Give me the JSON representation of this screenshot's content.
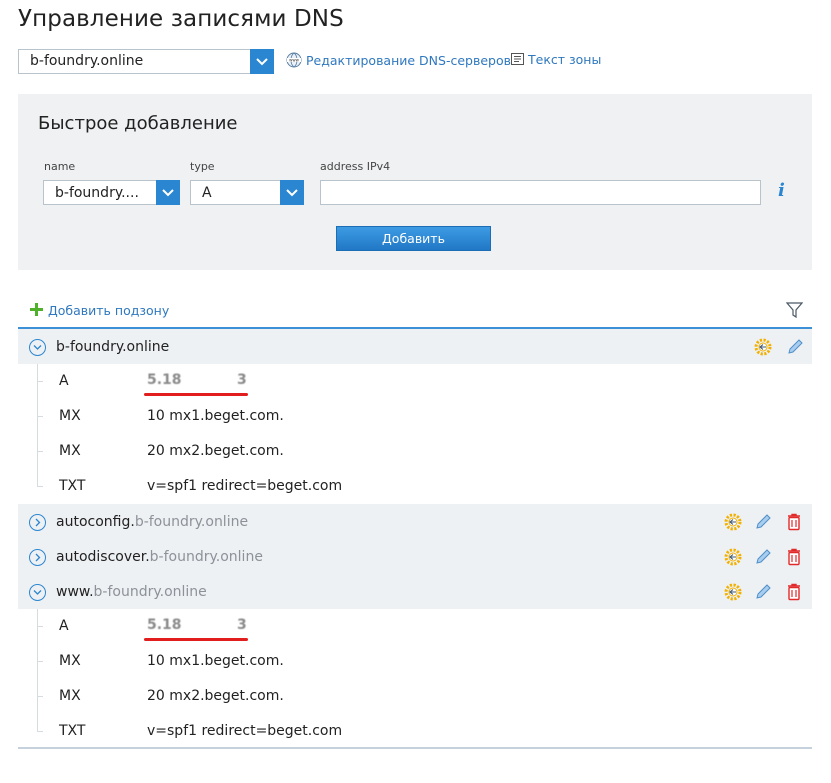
{
  "page": {
    "title": "Управление записями DNS"
  },
  "top": {
    "domain_value": "b-foundry.online",
    "edit_dns_label": "Редактирование DNS-серверов",
    "zone_text_label": "Текст зоны"
  },
  "quick_add": {
    "title": "Быстрое добавление",
    "name_label": "name",
    "name_value": "b-foundry....",
    "type_label": "type",
    "type_value": "A",
    "address_label": "address IPv4",
    "address_value": "",
    "add_button": "Добавить"
  },
  "toolbar": {
    "add_subzone": "Добавить подзону"
  },
  "zones": [
    {
      "prefix": "b-foundry.online",
      "suffix": "",
      "expanded": true,
      "records": [
        {
          "type": "A",
          "value_a": "5.18",
          "value_b": "3"
        },
        {
          "type": "MX",
          "value": "10 mx1.beget.com."
        },
        {
          "type": "MX",
          "value": "20 mx2.beget.com."
        },
        {
          "type": "TXT",
          "value": "v=spf1 redirect=beget.com"
        }
      ]
    },
    {
      "prefix": "autoconfig.",
      "suffix": "b-foundry.online",
      "expanded": false
    },
    {
      "prefix": "autodiscover.",
      "suffix": "b-foundry.online",
      "expanded": false
    },
    {
      "prefix": "www.",
      "suffix": "b-foundry.online",
      "expanded": true,
      "records": [
        {
          "type": "A",
          "value_a": "5.18",
          "value_b": "3"
        },
        {
          "type": "MX",
          "value": "10 mx1.beget.com."
        },
        {
          "type": "MX",
          "value": "20 mx2.beget.com."
        },
        {
          "type": "TXT",
          "value": "v=spf1 redirect=beget.com"
        }
      ]
    }
  ],
  "icons": {
    "dropdown": "chevron-down-icon",
    "edit_dns": "www-globe-icon",
    "zone_text": "document-icon",
    "info": "info-icon",
    "filter": "filter-icon",
    "settings": "gear-icon",
    "edit": "pencil-icon",
    "delete": "trash-icon"
  },
  "colors": {
    "accent": "#2b86d1",
    "link": "#2f78bf",
    "panel": "#eff1f3",
    "delete": "#e12b2b",
    "gear": "#f2b000",
    "highlight_underline": "#e11d1d"
  }
}
